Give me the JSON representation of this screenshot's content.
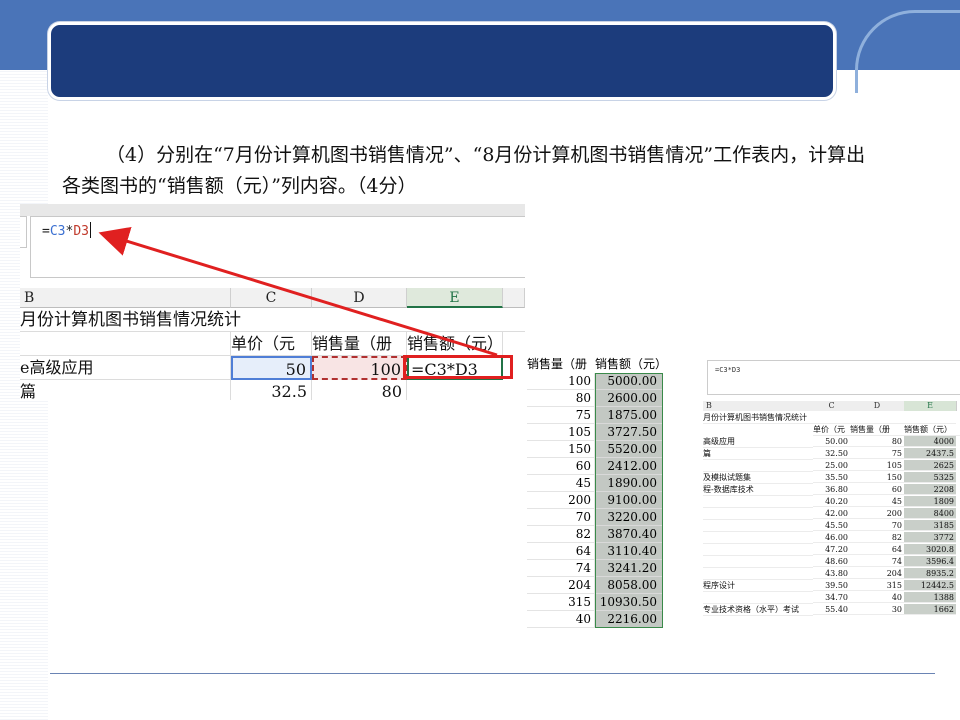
{
  "slide": {
    "instruction_line1": "（4）分别在“7月份计算机图书销售情况”、“8月份计算机图书销售情况”工作表内，计算出",
    "instruction_line2": "各类图书的“销售额（元）”列内容。（4分）",
    "colors": {
      "band": "#4a74b8",
      "title_bar": "#1c3c7c",
      "arrow": "#e02020"
    }
  },
  "screenshot_main": {
    "formula_bar": {
      "prefix": "=",
      "ref1": "C3",
      "op": "*",
      "ref2": "D3"
    },
    "column_headers": [
      "B",
      "C",
      "D",
      "E"
    ],
    "title_row": "月份计算机图书销售情况统计",
    "header_row": {
      "c": "单价（元",
      "d": "销售量（册",
      "e": "销售额（元）"
    },
    "row3": {
      "b": "e高级应用",
      "c": "50",
      "d": "100",
      "e": "=C3*D3"
    },
    "row4": {
      "b": "篇",
      "c": "32.5",
      "d": "80"
    }
  },
  "screenshot_mid": {
    "header_a": "销售量（册",
    "header_b": "销售额（元）",
    "rows": [
      [
        "100",
        "5000.00"
      ],
      [
        "80",
        "2600.00"
      ],
      [
        "75",
        "1875.00"
      ],
      [
        "105",
        "3727.50"
      ],
      [
        "150",
        "5520.00"
      ],
      [
        "60",
        "2412.00"
      ],
      [
        "45",
        "1890.00"
      ],
      [
        "200",
        "9100.00"
      ],
      [
        "70",
        "3220.00"
      ],
      [
        "82",
        "3870.40"
      ],
      [
        "64",
        "3110.40"
      ],
      [
        "74",
        "3241.20"
      ],
      [
        "204",
        "8058.00"
      ],
      [
        "315",
        "10930.50"
      ],
      [
        "40",
        "2216.00"
      ]
    ]
  },
  "screenshot_right": {
    "formula": "=C3*D3",
    "column_headers": [
      "B",
      "C",
      "D",
      "E"
    ],
    "title_row": "月份计算机图书销售情况统计",
    "header_row": [
      "单价（元",
      "销售量（册",
      "销售额（元）"
    ],
    "rows": [
      [
        "高级应用",
        "50.00",
        "80",
        "4000"
      ],
      [
        "篇",
        "32.50",
        "75",
        "2437.5"
      ],
      [
        "",
        "25.00",
        "105",
        "2625"
      ],
      [
        "及模拟试题集",
        "35.50",
        "150",
        "5325"
      ],
      [
        "程-数据库技术",
        "36.80",
        "60",
        "2208"
      ],
      [
        "",
        "40.20",
        "45",
        "1809"
      ],
      [
        "",
        "42.00",
        "200",
        "8400"
      ],
      [
        "",
        "45.50",
        "70",
        "3185"
      ],
      [
        "",
        "46.00",
        "82",
        "3772"
      ],
      [
        "",
        "47.20",
        "64",
        "3020.8"
      ],
      [
        "",
        "48.60",
        "74",
        "3596.4"
      ],
      [
        "",
        "43.80",
        "204",
        "8935.2"
      ],
      [
        "程序设计",
        "39.50",
        "315",
        "12442.5"
      ],
      [
        "",
        "34.70",
        "40",
        "1388"
      ],
      [
        "专业技术资格（水平）考试",
        "55.40",
        "30",
        "1662"
      ]
    ]
  }
}
